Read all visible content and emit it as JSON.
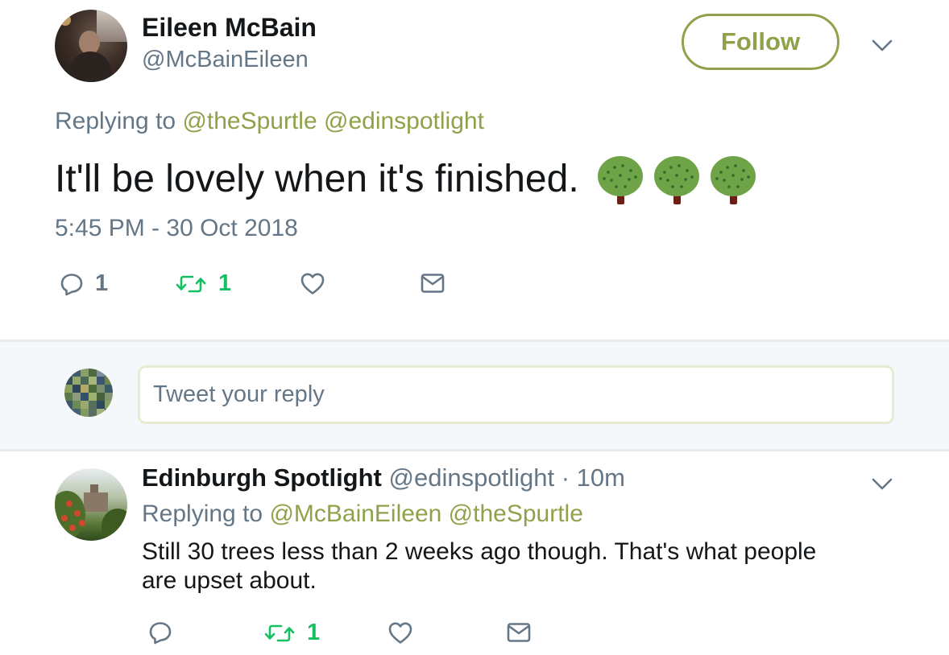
{
  "main_tweet": {
    "author_name": "Eileen McBain",
    "author_handle": "@McBainEileen",
    "follow_label": "Follow",
    "replying_prefix": "Replying to",
    "replying_mentions": [
      "@theSpurtle",
      "@edinspotlight"
    ],
    "text": "It'll be lovely when it's finished.",
    "emoji": [
      "deciduous-tree",
      "deciduous-tree",
      "deciduous-tree"
    ],
    "timestamp": "5:45 PM - 30 Oct 2018",
    "actions": {
      "reply_count": "1",
      "retweet_count": "1",
      "like_count": "",
      "dm_label": ""
    }
  },
  "composer": {
    "placeholder": "Tweet your reply"
  },
  "reply_tweet": {
    "author_name": "Edinburgh Spotlight",
    "author_handle": "@edinspotlight",
    "separator": "·",
    "time_ago": "10m",
    "replying_prefix": "Replying to",
    "replying_mentions": [
      "@McBainEileen",
      "@theSpurtle"
    ],
    "text": "Still 30 trees less than 2 weeks ago though. That's what people are upset about.",
    "actions": {
      "reply_count": "",
      "retweet_count": "1",
      "like_count": ""
    }
  },
  "colors": {
    "accent": "#8fa24a",
    "text_primary": "#14171a",
    "text_secondary": "#657786",
    "retweet_green": "#17bf63",
    "divider": "#e6ecf0",
    "composer_bg": "#f5f8fa"
  },
  "icons": [
    "reply-icon",
    "retweet-icon",
    "like-icon",
    "direct-message-icon",
    "chevron-down-icon"
  ]
}
